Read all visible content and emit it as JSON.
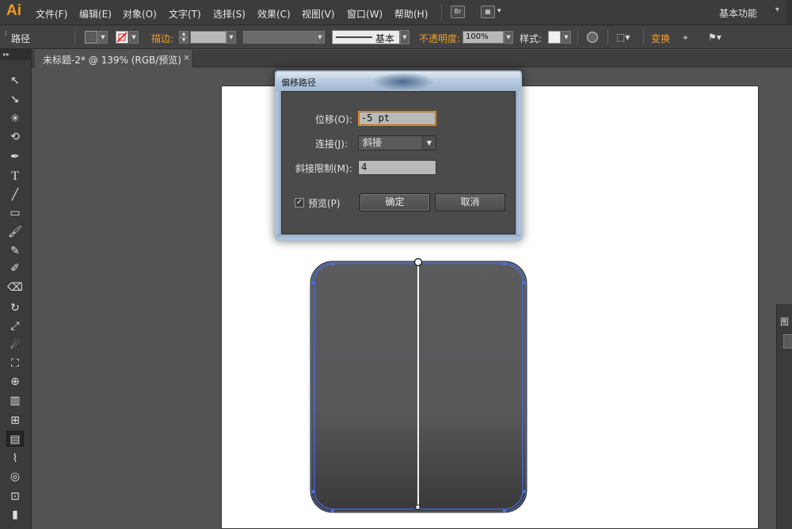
{
  "app": {
    "logo": "Ai",
    "menu": [
      "文件(F)",
      "编辑(E)",
      "对象(O)",
      "文字(T)",
      "选择(S)",
      "效果(C)",
      "视图(V)",
      "窗口(W)",
      "帮助(H)"
    ],
    "bridge_icon": "Br",
    "workspace": "基本功能"
  },
  "control_bar": {
    "object_type": "路径",
    "stroke_label": "描边:",
    "stroke_style": "基本",
    "opacity_label": "不透明度:",
    "opacity_value": "100%",
    "style_label": "样式:",
    "transform_label": "变换"
  },
  "document_tab": {
    "title": "未标题-2* @ 139% (RGB/预览)",
    "close": "×"
  },
  "tools": [
    "selection-tool",
    "direct-selection-tool",
    "magic-wand-tool",
    "lasso-tool",
    "pen-tool",
    "type-tool",
    "line-tool",
    "rectangle-tool",
    "paintbrush-tool",
    "pencil-tool",
    "blob-brush-tool",
    "eraser-tool",
    "rotate-tool",
    "scale-tool",
    "warp-tool",
    "free-transform-tool",
    "shape-builder-tool",
    "graph-tool",
    "mesh-tool",
    "gradient-tool",
    "eyedropper-tool",
    "blend-tool",
    "symbol-sprayer-tool",
    "column-graph-tool"
  ],
  "dialog": {
    "title": "偏移路径",
    "offset_label": "位移(O):",
    "offset_value": "-5 pt",
    "joins_label": "连接(J):",
    "joins_value": "斜接",
    "miter_label": "斜接限制(M):",
    "miter_value": "4",
    "preview_label": "预览(P)",
    "preview_checked": true,
    "ok_label": "确定",
    "cancel_label": "取消"
  },
  "colors": {
    "accent": "#f0a030",
    "selection": "#4a6fe0",
    "shape_top": "#5b5b5c",
    "shape_bottom": "#3a393a"
  }
}
